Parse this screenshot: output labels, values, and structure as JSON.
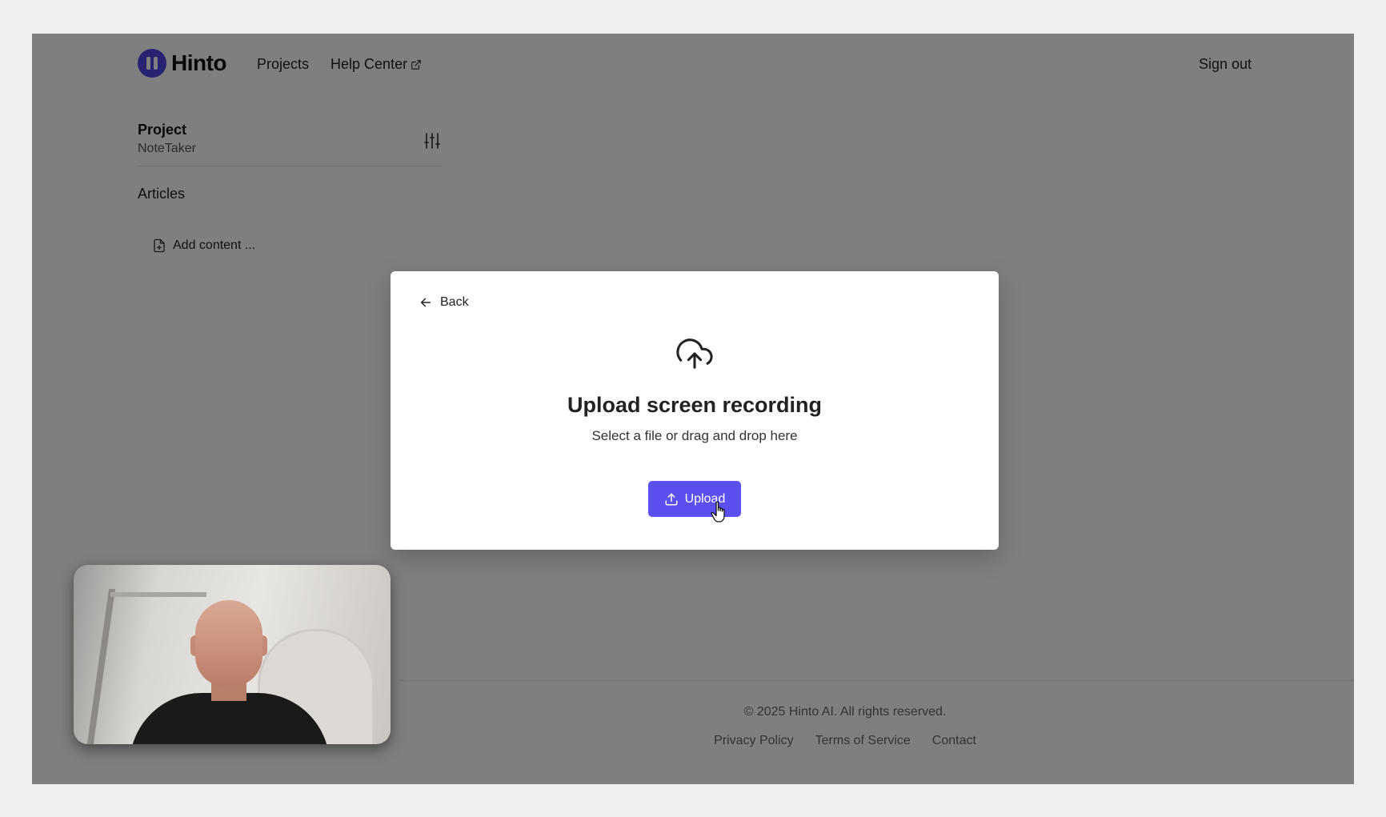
{
  "app": {
    "brand": "Hinto",
    "nav": [
      {
        "label": "Projects"
      },
      {
        "label": "Help Center"
      }
    ],
    "sign_out": "Sign out"
  },
  "sidebar": {
    "project_label": "Project",
    "project_name": "NoteTaker",
    "articles_label": "Articles",
    "add_content": "Add content ..."
  },
  "footer": {
    "copyright": "© 2025 Hinto AI. All rights reserved.",
    "links": [
      "Privacy Policy",
      "Terms of Service",
      "Contact"
    ]
  },
  "modal": {
    "back_label": "Back",
    "title": "Upload screen recording",
    "subtitle": "Select a file or drag and drop here",
    "upload_label": "Upload"
  },
  "colors": {
    "accent": "#5b4ff0",
    "brand": "#4f46e5"
  },
  "icons": [
    "external-link-icon",
    "sliders-icon",
    "file-plus-icon",
    "arrow-left-icon",
    "cloud-upload-icon",
    "upload-icon",
    "hand-cursor-icon"
  ]
}
